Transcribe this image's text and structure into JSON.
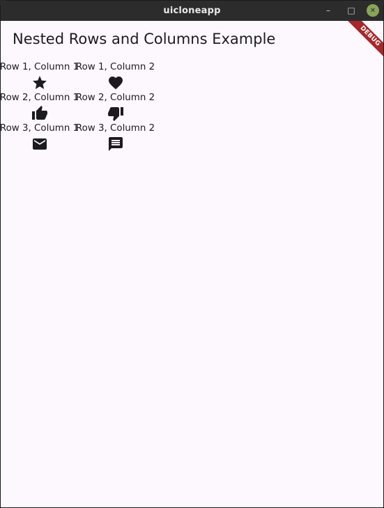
{
  "window": {
    "title": "uicloneapp",
    "minimize_glyph": "–",
    "maximize_glyph": "□",
    "close_glyph": "✕"
  },
  "app": {
    "title": "Nested Rows and Columns Example",
    "debug_label": "DEBUG"
  },
  "grid": {
    "rows": [
      {
        "cells": [
          {
            "label": "Row 1, Column 1",
            "icon": "star-icon"
          },
          {
            "label": "Row 1, Column 2",
            "icon": "heart-icon"
          }
        ]
      },
      {
        "cells": [
          {
            "label": "Row 2, Column 1",
            "icon": "thumb-up-icon"
          },
          {
            "label": "Row 2, Column 2",
            "icon": "thumb-down-icon"
          }
        ]
      },
      {
        "cells": [
          {
            "label": "Row 3, Column 1",
            "icon": "email-icon"
          },
          {
            "label": "Row 3, Column 2",
            "icon": "message-icon"
          }
        ]
      }
    ]
  },
  "colors": {
    "background": "#fdf7fe",
    "text": "#1d1b20",
    "titlebar": "#2c2c2c",
    "close_button": "#8aa45a",
    "debug_banner": "#a4282c"
  }
}
